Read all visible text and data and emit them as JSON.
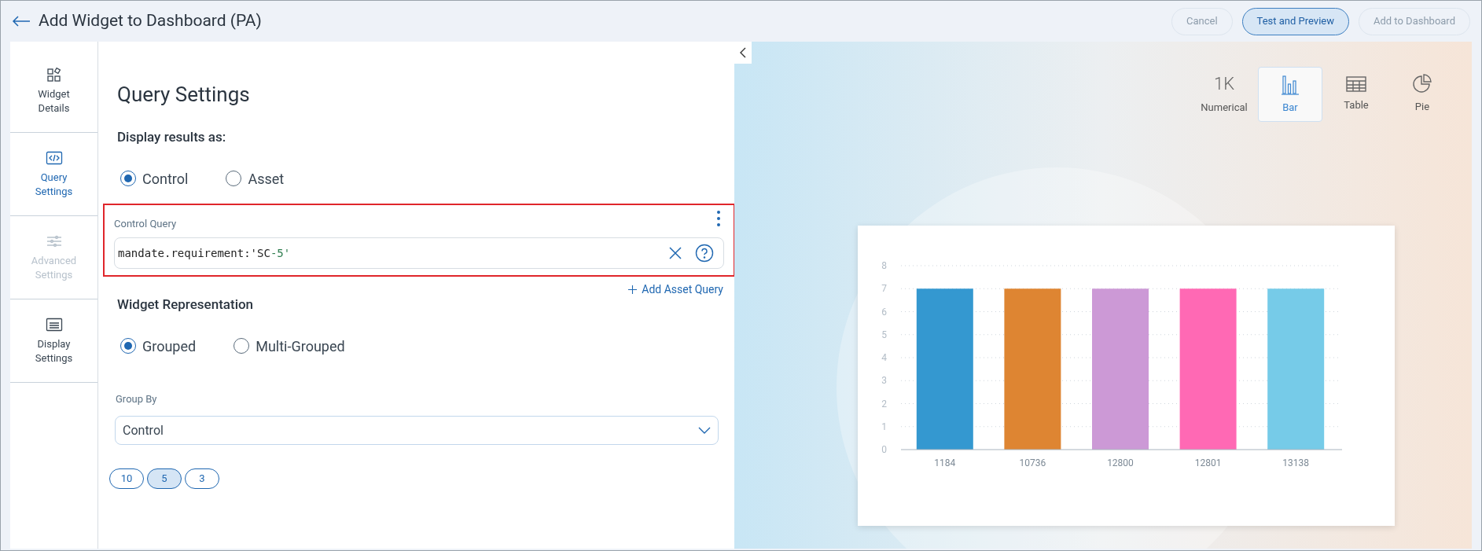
{
  "header": {
    "title": "Add Widget to Dashboard (PA)",
    "buttons": [
      {
        "label": "Cancel",
        "kind": "ghost",
        "disabled": true
      },
      {
        "label": "Test and Preview",
        "kind": "primary",
        "disabled": false
      },
      {
        "label": "Add to Dashboard",
        "kind": "ghost",
        "disabled": true
      }
    ]
  },
  "sidebar": {
    "items": [
      {
        "label": "Widget Details",
        "kind": "details",
        "selected": false,
        "disabled": false
      },
      {
        "label": "Query Settings",
        "kind": "query",
        "selected": true,
        "disabled": false
      },
      {
        "label": "Advanced Settings",
        "kind": "advanced",
        "selected": false,
        "disabled": true
      },
      {
        "label": "Display Settings",
        "kind": "display",
        "selected": false,
        "disabled": false
      }
    ]
  },
  "query_settings": {
    "title": "Query Settings",
    "display_label": "Display results as:",
    "display_options": [
      {
        "label": "Control",
        "selected": true
      },
      {
        "label": "Asset",
        "selected": false
      }
    ],
    "control_query": {
      "label": "Control Query",
      "value_prefix": "mandate.requirement:'SC",
      "value_suffix": "-5'"
    },
    "add_asset_query": "Add Asset Query",
    "representation_label": "Widget Representation",
    "representation_options": [
      {
        "label": "Grouped",
        "selected": true
      },
      {
        "label": "Multi-Grouped",
        "selected": false
      }
    ],
    "group_by": {
      "label": "Group By",
      "value": "Control"
    },
    "limits": [
      {
        "label": "10",
        "selected": false
      },
      {
        "label": "5",
        "selected": true
      },
      {
        "label": "3",
        "selected": false
      }
    ]
  },
  "preview": {
    "types": [
      {
        "label": "Numerical",
        "kind": "numerical",
        "icon_text": "1K",
        "selected": false
      },
      {
        "label": "Bar",
        "kind": "bar",
        "selected": true
      },
      {
        "label": "Table",
        "kind": "table",
        "selected": false
      },
      {
        "label": "Pie",
        "kind": "pie",
        "selected": false
      }
    ],
    "chart_data": {
      "type": "bar",
      "categories": [
        "1184",
        "10736",
        "12800",
        "12801",
        "13138"
      ],
      "values": [
        7,
        7,
        7,
        7,
        7
      ],
      "colors": [
        "#3498d0",
        "#de8532",
        "#cc99d6",
        "#ff69b4",
        "#76cbe8"
      ],
      "grid": true,
      "ylim": [
        0,
        8
      ],
      "yticks": [
        0,
        1,
        2,
        3,
        4,
        5,
        6,
        7,
        8
      ]
    }
  }
}
